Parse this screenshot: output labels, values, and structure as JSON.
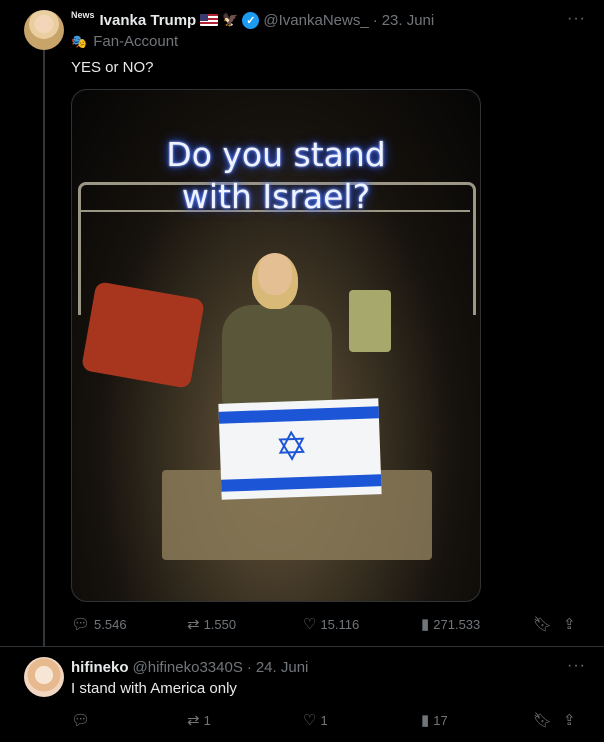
{
  "tweet": {
    "news_tag": "News",
    "name": "Ivanka Trump",
    "handle": "@IvankaNews_",
    "sep": "·",
    "date": "23. Juni",
    "label": "Fan-Account",
    "text": "YES or NO?",
    "image_text_line1": "Do you stand",
    "image_text_line2": "with Israel?",
    "replies": "5.546",
    "reposts": "1.550",
    "likes": "15.116",
    "views": "271.533"
  },
  "reply": {
    "name": "hifineko",
    "handle": "@hifineko3340S",
    "sep": "·",
    "date": "24. Juni",
    "text": "I stand with America only",
    "replies": "",
    "reposts": "1",
    "likes": "1",
    "views": "17"
  },
  "icons": {
    "more": "more-icon",
    "reply": "reply-icon",
    "repost": "repost-icon",
    "like": "heart-icon",
    "views": "views-icon",
    "bookmark": "bookmark-icon",
    "share": "share-icon"
  },
  "colors": {
    "background": "#000000",
    "text": "#e7e9ea",
    "muted": "#71767b",
    "verified": "#1d9bf0",
    "border": "#2f3336"
  }
}
